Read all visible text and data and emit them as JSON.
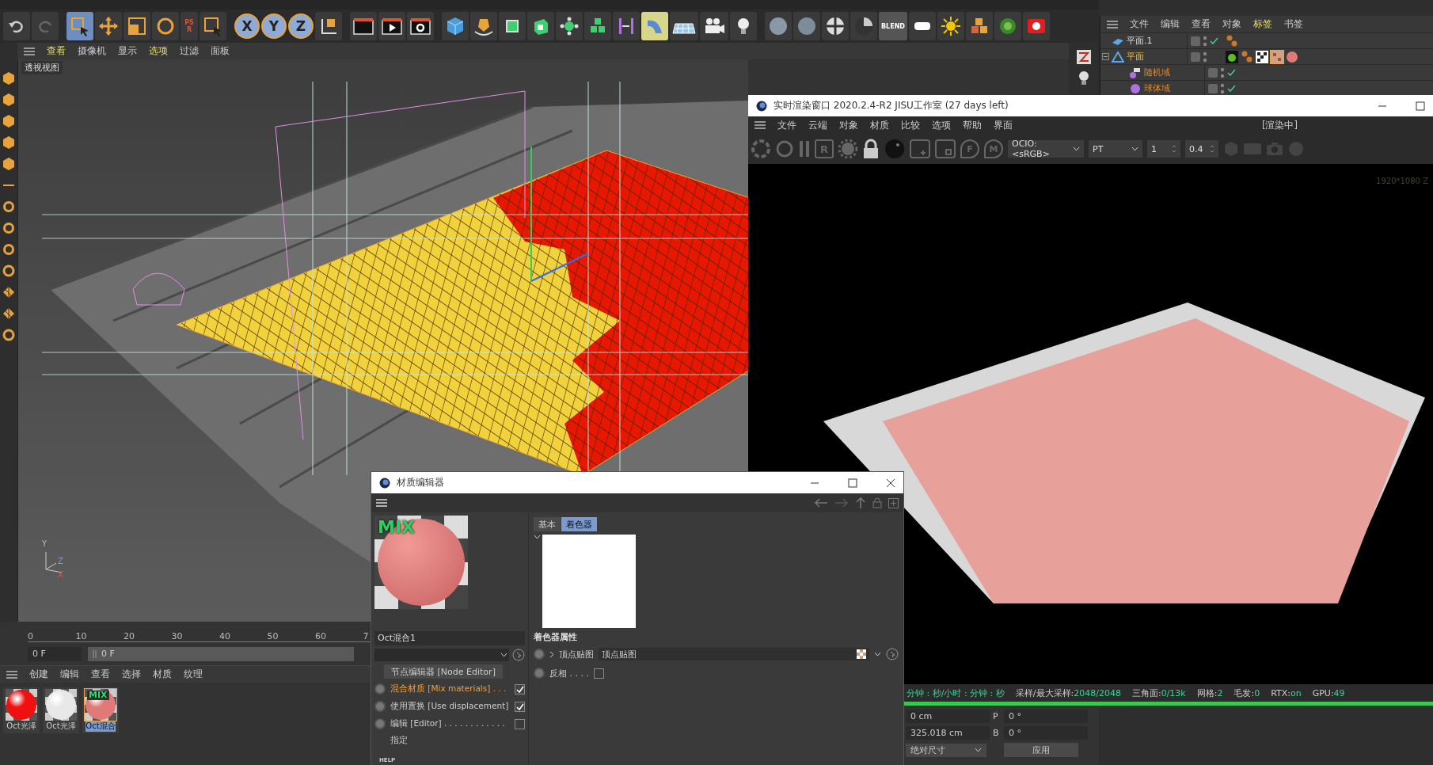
{
  "toolbar": {
    "psr": "PSR",
    "axes": [
      {
        "label": "X",
        "selected": true
      },
      {
        "label": "Y",
        "selected": true
      },
      {
        "label": "Z",
        "selected": true
      }
    ],
    "blend": "BLEND"
  },
  "viewport": {
    "title": "透视视图",
    "menu": [
      {
        "label": "查看",
        "highlighted": true
      },
      {
        "label": "摄像机",
        "highlighted": false
      },
      {
        "label": "显示",
        "highlighted": false
      },
      {
        "label": "选项",
        "highlighted": true
      },
      {
        "label": "过滤",
        "highlighted": false
      },
      {
        "label": "面板",
        "highlighted": false
      }
    ],
    "axis_labels": [
      "Y",
      "Z",
      "X"
    ]
  },
  "timeline": {
    "ticks": [
      "0",
      "10",
      "20",
      "30",
      "40",
      "50",
      "60",
      "7"
    ],
    "frame_field": "0 F",
    "frame_slider": "0 F"
  },
  "material_manager": {
    "menu": [
      "创建",
      "编辑",
      "查看",
      "选择",
      "材质",
      "纹理"
    ],
    "materials": [
      {
        "name": "Oct光泽",
        "color": "#f01010",
        "selected": false
      },
      {
        "name": "Oct光泽",
        "color": "#e8e8e8",
        "selected": false
      },
      {
        "name": "Oct混合",
        "color": "#e07a78",
        "badge": "MIX",
        "selected": true
      }
    ]
  },
  "coordinates": {
    "rows": [
      {
        "value": "0 cm",
        "axis": "P",
        "angle": "0 °"
      },
      {
        "value": "325.018 cm",
        "axis": "B",
        "angle": "0 °"
      }
    ],
    "mode": "绝对尺寸",
    "apply": "应用"
  },
  "object_manager": {
    "menu": [
      {
        "label": "文件",
        "highlighted": false
      },
      {
        "label": "编辑",
        "highlighted": false
      },
      {
        "label": "查看",
        "highlighted": false
      },
      {
        "label": "对象",
        "highlighted": false
      },
      {
        "label": "标签",
        "highlighted": true
      },
      {
        "label": "书签",
        "highlighted": false
      }
    ],
    "objects": [
      {
        "name": "平面.1",
        "kind": "plane",
        "selected": false,
        "checked": true
      },
      {
        "name": "平面",
        "kind": "cloner",
        "selected": true,
        "checked": false,
        "expanded": true,
        "children": [
          {
            "name": "随机域",
            "kind": "random-field",
            "selected": false,
            "checked": true
          },
          {
            "name": "球体域",
            "kind": "sphere-field",
            "selected": false,
            "checked": true
          }
        ]
      }
    ]
  },
  "render_window": {
    "title": "实时渲染窗口 2020.2.4-R2 JISU工作室 (27 days left)",
    "menu": [
      "文件",
      "云端",
      "对象",
      "材质",
      "比较",
      "选项",
      "帮助",
      "界面"
    ],
    "state": "[渲染中]",
    "icon_letters": [
      "R",
      "F",
      "M"
    ],
    "color_space": "OCIO:<sRGB>",
    "kernel": "PT",
    "spin_1": "1",
    "spin_2": "0.4",
    "resolution": "1920*1080 Z",
    "status": [
      {
        "label": "分钟 : 秒/小时 : 分钟 : 秒"
      },
      {
        "label": "采样/最大采样:",
        "value": "2048/2048"
      },
      {
        "label": "三角面:",
        "value": "0/13k"
      },
      {
        "label": "网格:",
        "value": "2"
      },
      {
        "label": "毛发:",
        "value": "0"
      },
      {
        "label": "RTX:",
        "value": "on"
      },
      {
        "label": "GPU:",
        "value": "49"
      }
    ],
    "progress": {
      "level": 1.0
    }
  },
  "material_editor": {
    "title": "材质编辑器",
    "preview_badge": "MIX",
    "name": "Oct混合1",
    "node_editor": "节点编辑器 [Node Editor]",
    "options": [
      {
        "label": "混合材质 [Mix materials] . . .",
        "checked": true,
        "highlighted": true
      },
      {
        "label": "使用置换 [Use displacement]",
        "checked": true,
        "highlighted": false
      },
      {
        "label": "编辑 [Editor] . . . . . . . . . . . .",
        "checked": false,
        "highlighted": false
      }
    ],
    "assign": "指定",
    "help": "HELP",
    "tabs": [
      {
        "label": "基本",
        "selected": false
      },
      {
        "label": "着色器",
        "selected": true
      }
    ],
    "section": "着色器属性",
    "params": [
      {
        "kind": "shader",
        "label": "顶点贴图",
        "value": "顶点贴图"
      },
      {
        "kind": "checkbox",
        "label": "反相 . . . .",
        "checked": false
      }
    ]
  }
}
